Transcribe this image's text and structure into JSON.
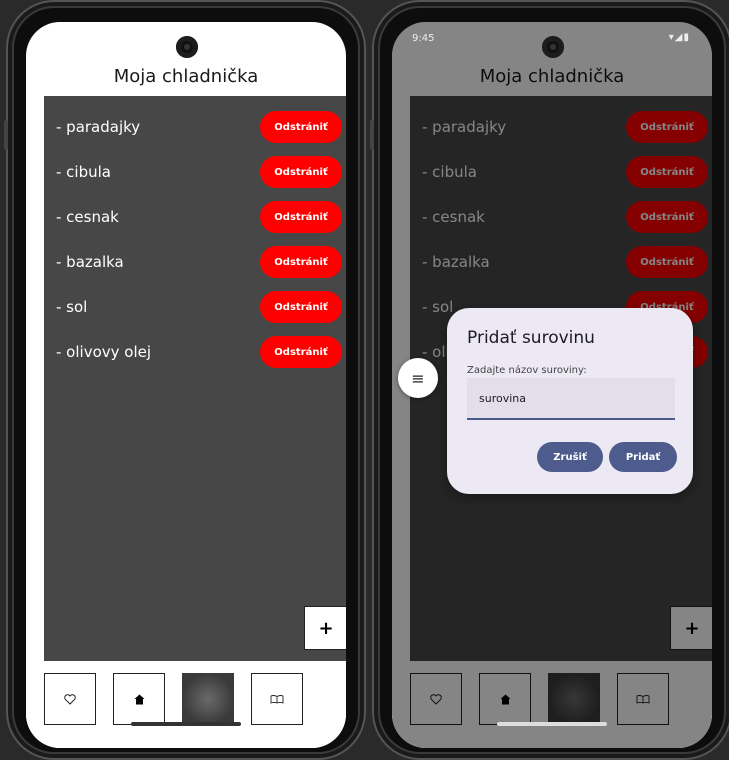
{
  "left_phone": {
    "status": {
      "time": ""
    },
    "title": "Moja chladnička",
    "remove_label": "Odstrániť",
    "items": [
      {
        "name": "- paradajky"
      },
      {
        "name": "- cibula"
      },
      {
        "name": "- cesnak"
      },
      {
        "name": "- bazalka"
      },
      {
        "name": "- sol"
      },
      {
        "name": "- olivovy olej"
      }
    ],
    "add_label": "+",
    "nav": [
      "heart-icon",
      "home-icon",
      "fridge-image",
      "book-icon"
    ]
  },
  "right_phone": {
    "status": {
      "time": "9:45",
      "signal": "▾◢▮"
    },
    "title": "Moja chladnička",
    "remove_label": "Odstrániť",
    "items": [
      {
        "name": "- paradajky"
      },
      {
        "name": "- cibula"
      },
      {
        "name": "- cesnak"
      },
      {
        "name": "- bazalka"
      },
      {
        "name": "- sol"
      },
      {
        "name": "- olivovy olej"
      }
    ],
    "add_label": "+",
    "menu_icon": "≡",
    "dialog": {
      "title": "Pridať surovinu",
      "label": "Zadajte názov suroviny:",
      "input_value": "surovina",
      "cancel_label": "Zrušiť",
      "confirm_label": "Pridať"
    }
  },
  "colors": {
    "panel": "#474747",
    "remove_button": "#ff0000",
    "dialog_background": "#ece9f5",
    "dialog_button": "#4d5c8c"
  }
}
